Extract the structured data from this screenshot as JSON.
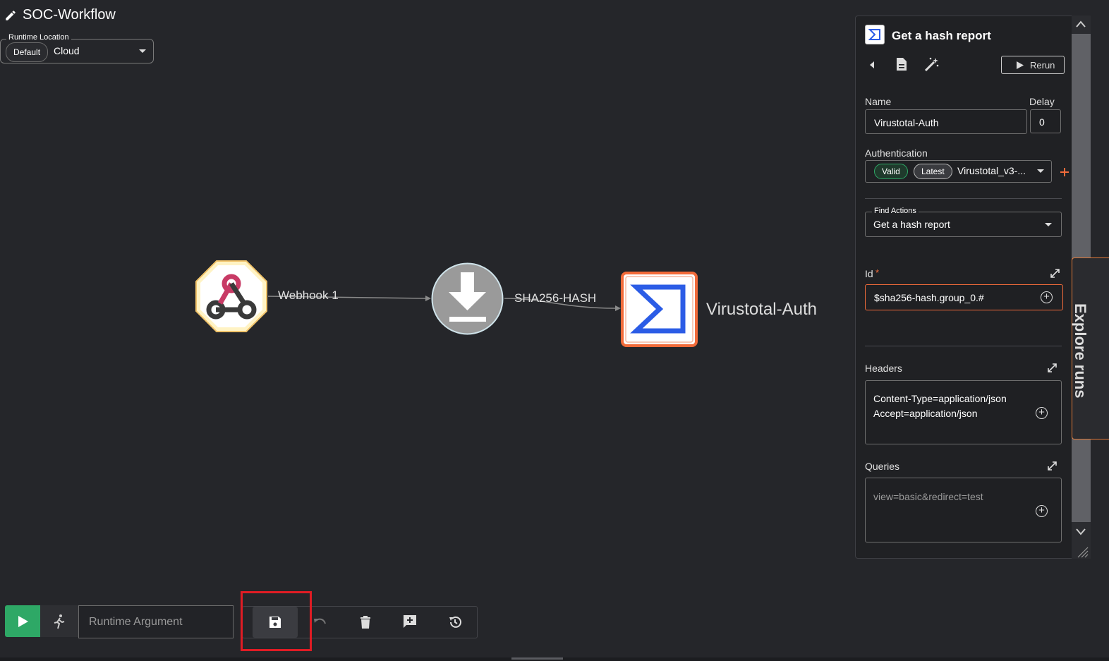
{
  "header": {
    "title": "SOC-Workflow",
    "runtime_location_label": "Runtime Location",
    "runtime_location_chip": "Default",
    "runtime_location_value": "Cloud"
  },
  "canvas": {
    "nodes": [
      {
        "id": "webhook",
        "icon": "webhook-icon"
      },
      {
        "id": "download",
        "icon": "download-icon"
      },
      {
        "id": "virustotal",
        "icon": "sigma-icon",
        "label": "Virustotal-Auth"
      }
    ],
    "edges": [
      {
        "label": "Webhook 1"
      },
      {
        "label": "SHA256-HASH"
      }
    ]
  },
  "panel": {
    "title": "Get a hash report",
    "rerun_label": "Rerun",
    "name_label": "Name",
    "name_value": "Virustotal-Auth",
    "delay_label": "Delay",
    "delay_value": "0",
    "auth_label": "Authentication",
    "auth_valid": "Valid",
    "auth_latest": "Latest",
    "auth_value": "Virustotal_v3-...",
    "find_actions_label": "Find Actions",
    "find_actions_value": "Get a hash report",
    "id_label": "Id",
    "id_required": "*",
    "id_value": "$sha256-hash.group_0.#",
    "headers_label": "Headers",
    "headers_line1": "Content-Type=application/json",
    "headers_line2": "Accept=application/json",
    "queries_label": "Queries",
    "queries_placeholder": "view=basic&redirect=test",
    "side_tab_label": "Explore runs"
  },
  "toolbar": {
    "runtime_argument_placeholder": "Runtime Argument"
  },
  "colors": {
    "run_green": "#2ea866",
    "accent_orange": "#f26b3a",
    "highlight_red": "#e01c24",
    "sigma_blue": "#2b5ce6",
    "webhook_bg": "#fff3c4"
  }
}
